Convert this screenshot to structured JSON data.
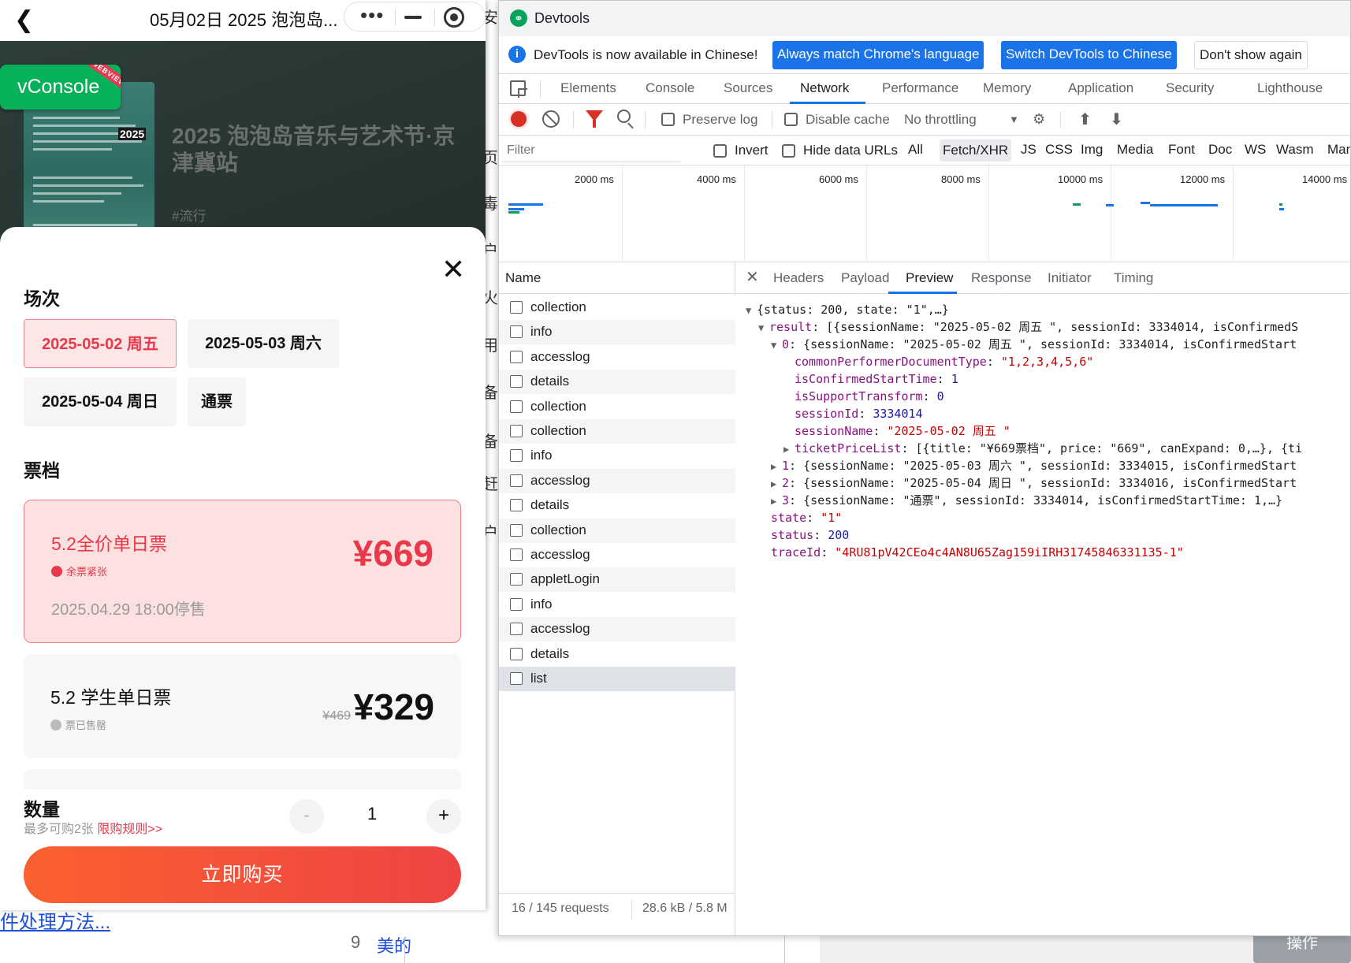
{
  "background_page": {
    "side_chars": [
      "安",
      "页",
      "毒",
      "户",
      "火",
      "用",
      "备",
      "备",
      "赶",
      "户"
    ],
    "bottom_link": "件处理方法...",
    "bottom_num": "9",
    "bottom_text": "美的",
    "bottom_button": "操作"
  },
  "miniprogram": {
    "nav_title": "05月02日 2025 泡泡岛...",
    "vconsole_label": "vConsole",
    "vconsole_ribbon": "WEBVIEW",
    "poster_year": "2025",
    "event_title": "2025 泡泡岛音乐与艺术节·京津冀站",
    "event_tag": "#流行",
    "session_label": "场次",
    "sessions": [
      {
        "label": "2025-05-02 周五",
        "active": true
      },
      {
        "label": "2025-05-03 周六",
        "active": false
      },
      {
        "label": "2025-05-04 周日",
        "active": false
      },
      {
        "label": "通票",
        "active": false
      }
    ],
    "tier_label": "票档",
    "tickets": [
      {
        "name": "5.2全价单日票",
        "status": "余票紧张",
        "date": "2025.04.29 18:00停售",
        "price": "¥669",
        "orig": ""
      },
      {
        "name": "5.2 学生单日票",
        "status": "票已售罄",
        "date": "",
        "price": "¥329",
        "orig": "¥469"
      }
    ],
    "quantity_label": "数量",
    "quantity_note": "最多可购2张",
    "quantity_rule": "限购规则>>",
    "quantity_value": "1",
    "minus": "-",
    "plus": "+",
    "buy_label": "立即购买"
  },
  "devtools": {
    "window_title": "Devtools",
    "infobar": {
      "message": "DevTools is now available in Chinese!",
      "btn_match": "Always match Chrome's language",
      "btn_switch": "Switch DevTools to Chinese",
      "btn_dismiss": "Don't show again"
    },
    "tabs": [
      "Elements",
      "Console",
      "Sources",
      "Network",
      "Performance",
      "Memory",
      "Application",
      "Security",
      "Lighthouse"
    ],
    "active_tab": "Network",
    "toolbar": {
      "preserve_log": "Preserve log",
      "disable_cache": "Disable cache",
      "throttling": "No throttling"
    },
    "filterbar": {
      "placeholder": "Filter",
      "invert": "Invert",
      "hide_data_urls": "Hide data URLs",
      "types": [
        "All",
        "Fetch/XHR",
        "JS",
        "CSS",
        "Img",
        "Media",
        "Font",
        "Doc",
        "WS",
        "Wasm",
        "Man"
      ],
      "active_type": "Fetch/XHR"
    },
    "timeline_labels": [
      "2000 ms",
      "4000 ms",
      "6000 ms",
      "8000 ms",
      "10000 ms",
      "12000 ms",
      "14000 ms"
    ],
    "name_header": "Name",
    "requests": [
      "collection",
      "info",
      "accesslog",
      "details",
      "collection",
      "collection",
      "info",
      "accesslog",
      "details",
      "collection",
      "accesslog",
      "appletLogin",
      "info",
      "accesslog",
      "details",
      "list"
    ],
    "selected_request": "list",
    "status_requests": "16 / 145 requests",
    "status_size": "28.6 kB / 5.8 M",
    "detail_tabs": [
      "Headers",
      "Payload",
      "Preview",
      "Response",
      "Initiator",
      "Timing"
    ],
    "active_detail_tab": "Preview",
    "preview_lines": [
      {
        "tri": "▼",
        "parts": [
          [
            "p",
            "{status: 200, state: \"1\",…}"
          ]
        ]
      },
      {
        "tri": "▼",
        "parts": [
          [
            "k",
            "result"
          ],
          [
            "p",
            ": [{sessionName: \"2025-05-02 周五 \", sessionId: 3334014, isConfirmedS"
          ]
        ]
      },
      {
        "tri": "▼",
        "parts": [
          [
            "k",
            "0"
          ],
          [
            "p",
            ": {sessionName: \"2025-05-02 周五 \", sessionId: 3334014, isConfirmedStart"
          ]
        ]
      },
      {
        "tri": "",
        "parts": [
          [
            "k",
            "commonPerformerDocumentType"
          ],
          [
            "p",
            ": "
          ],
          [
            "s",
            "\"1,2,3,4,5,6\""
          ]
        ]
      },
      {
        "tri": "",
        "parts": [
          [
            "k",
            "isConfirmedStartTime"
          ],
          [
            "p",
            ": "
          ],
          [
            "n",
            "1"
          ]
        ]
      },
      {
        "tri": "",
        "parts": [
          [
            "k",
            "isSupportTransform"
          ],
          [
            "p",
            ": "
          ],
          [
            "n",
            "0"
          ]
        ]
      },
      {
        "tri": "",
        "parts": [
          [
            "k",
            "sessionId"
          ],
          [
            "p",
            ": "
          ],
          [
            "n",
            "3334014"
          ]
        ]
      },
      {
        "tri": "",
        "parts": [
          [
            "k",
            "sessionName"
          ],
          [
            "p",
            ": "
          ],
          [
            "s",
            "\"2025-05-02 周五 \""
          ]
        ]
      },
      {
        "tri": "▶",
        "parts": [
          [
            "k",
            "ticketPriceList"
          ],
          [
            "p",
            ": [{title: \"¥669票档\", price: \"669\", canExpand: 0,…}, {ti"
          ]
        ]
      },
      {
        "tri": "▶",
        "parts": [
          [
            "k",
            "1"
          ],
          [
            "p",
            ": {sessionName: \"2025-05-03 周六 \", sessionId: 3334015, isConfirmedStart"
          ]
        ]
      },
      {
        "tri": "▶",
        "parts": [
          [
            "k",
            "2"
          ],
          [
            "p",
            ": {sessionName: \"2025-05-04 周日 \", sessionId: 3334016, isConfirmedStart"
          ]
        ]
      },
      {
        "tri": "▶",
        "parts": [
          [
            "k",
            "3"
          ],
          [
            "p",
            ": {sessionName: \"通票\", sessionId: 3334014, isConfirmedStartTime: 1,…}"
          ]
        ]
      },
      {
        "tri": "",
        "parts": [
          [
            "k",
            "state"
          ],
          [
            "p",
            ": "
          ],
          [
            "s",
            "\"1\""
          ]
        ]
      },
      {
        "tri": "",
        "parts": [
          [
            "k",
            "status"
          ],
          [
            "p",
            ": "
          ],
          [
            "n",
            "200"
          ]
        ]
      },
      {
        "tri": "",
        "parts": [
          [
            "k",
            "traceId"
          ],
          [
            "p",
            ": "
          ],
          [
            "s",
            "\"4RU81pV42CEo4c4AN8U65Zag159iIRH31745846331135-1\""
          ]
        ]
      }
    ]
  },
  "colors": {
    "accent_red": "#e8384a",
    "vconsole_green": "#07b15a",
    "devtools_blue": "#1a73e8"
  }
}
